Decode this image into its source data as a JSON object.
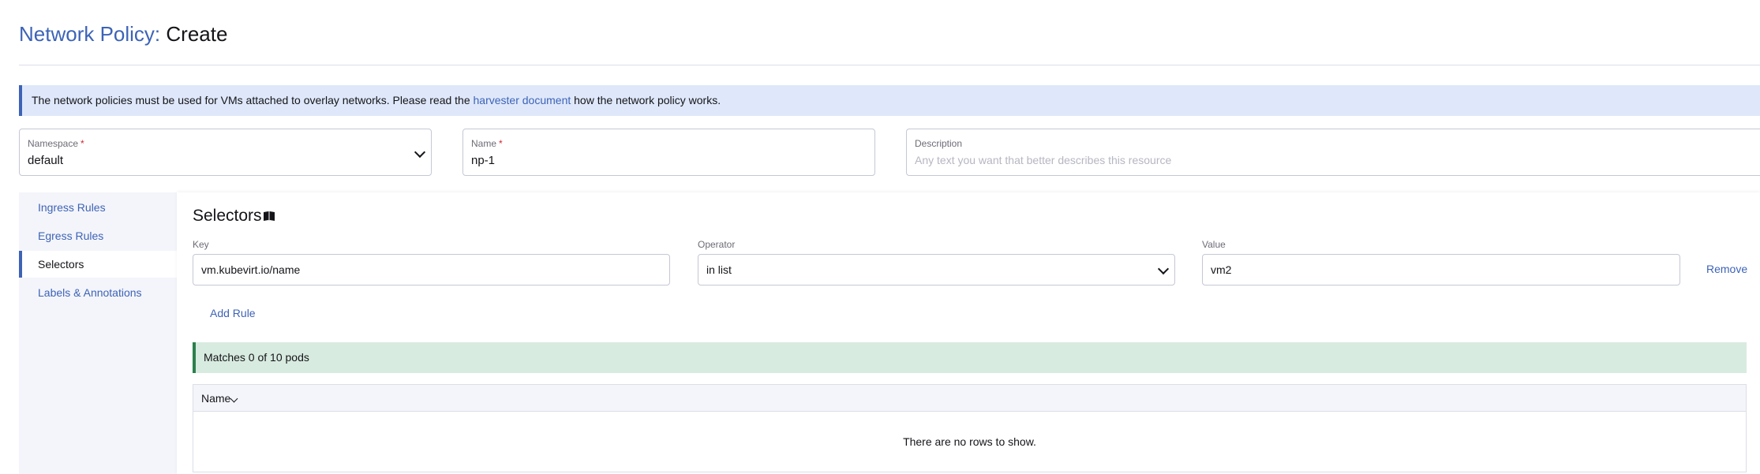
{
  "header": {
    "crumb": "Network Policy:",
    "action": "Create"
  },
  "banner": {
    "text_before": "The network policies must be used for VMs attached to overlay networks. Please read the ",
    "link": "harvester document",
    "text_after": " how the network policy works."
  },
  "form": {
    "namespace": {
      "label": "Namespace",
      "required": "*",
      "value": "default"
    },
    "name": {
      "label": "Name",
      "required": "*",
      "value": "np-1"
    },
    "description": {
      "label": "Description",
      "placeholder": "Any text you want that better describes this resource"
    }
  },
  "sidebar": {
    "items": [
      {
        "label": "Ingress Rules",
        "active": false
      },
      {
        "label": "Egress Rules",
        "active": false
      },
      {
        "label": "Selectors",
        "active": true
      },
      {
        "label": "Labels & Annotations",
        "active": false
      }
    ]
  },
  "selectors": {
    "title": "Selectors",
    "key_label": "Key",
    "operator_label": "Operator",
    "value_label": "Value",
    "rule": {
      "key": "vm.kubevirt.io/name",
      "operator": "in list",
      "value": "vm2"
    },
    "remove_label": "Remove",
    "add_rule_label": "Add Rule",
    "match_text": "Matches 0 of 10 pods",
    "table": {
      "column_name": "Name",
      "empty_text": "There are no rows to show."
    }
  },
  "colors": {
    "accent": "#3d63b7",
    "banner_bg": "#dfe8fa",
    "success_bg": "#d8ebe0",
    "success_border": "#2c7f4c"
  }
}
